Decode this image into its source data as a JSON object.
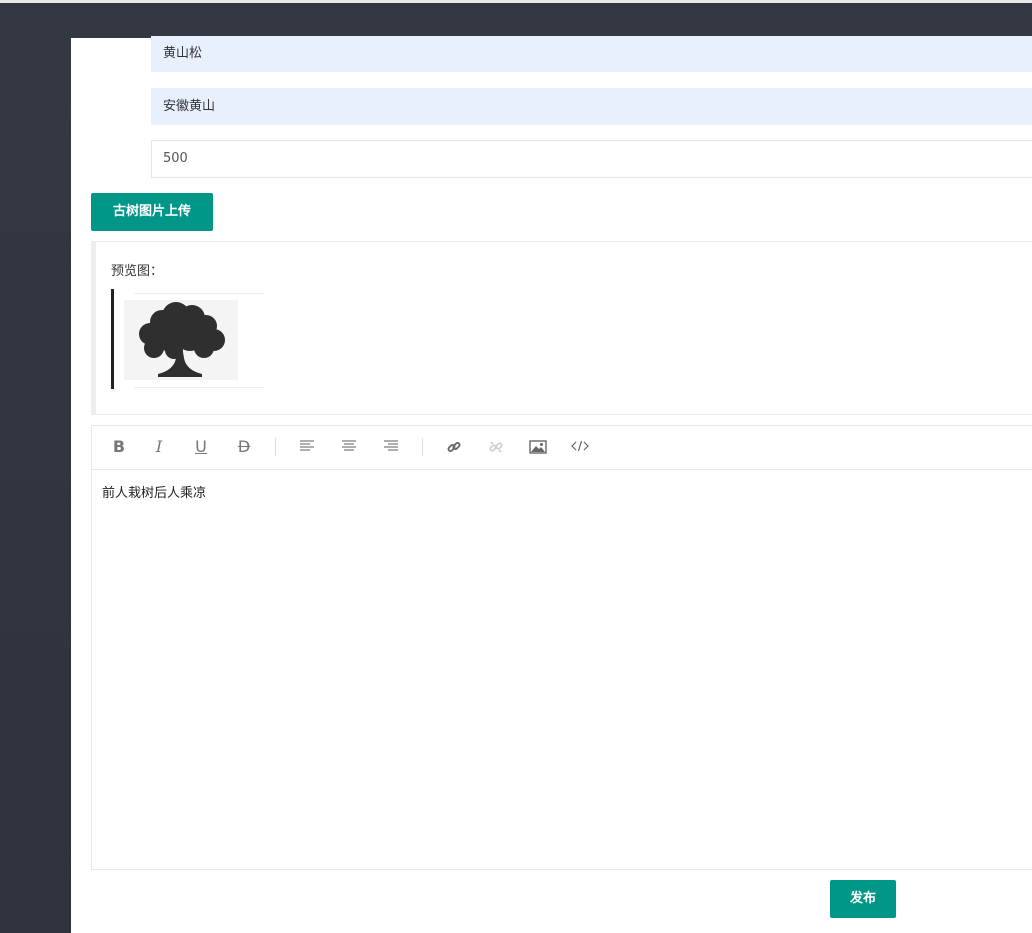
{
  "form": {
    "tree_name": "黄山松",
    "location": "安徽黄山",
    "age": "500",
    "upload_button": "古树图片上传",
    "preview_label": "预览图：",
    "preview_image": "tree-silhouette-icon"
  },
  "editor": {
    "toolbar": {
      "bold": "B",
      "italic": "I",
      "underline": "U",
      "strikethrough": "D"
    },
    "tool_icons": [
      "bold-icon",
      "italic-icon",
      "underline-icon",
      "strikethrough-icon",
      "align-left-icon",
      "align-center-icon",
      "align-right-icon",
      "link-icon",
      "unlink-icon",
      "image-icon",
      "code-icon"
    ],
    "content": "前人栽树后人乘凉"
  },
  "actions": {
    "publish": "发布"
  },
  "colors": {
    "primary": "#009688",
    "autofill": "#e8f0fe",
    "background": "#343840"
  }
}
